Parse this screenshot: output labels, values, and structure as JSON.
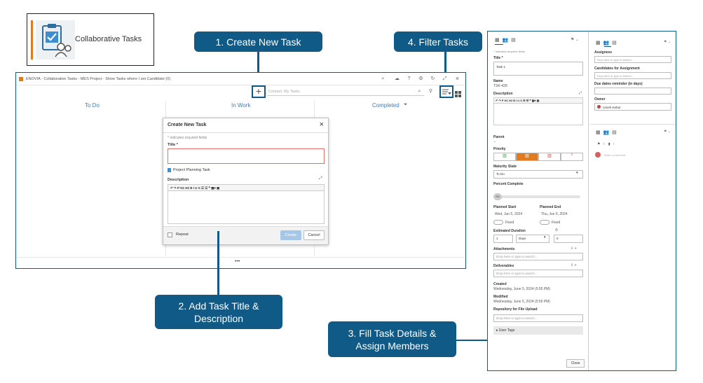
{
  "app_tile": {
    "name": "Collaborative Tasks",
    "icon": "clipboard-check-users-icon",
    "accent": "#e07b1f"
  },
  "callouts": {
    "create": "1. Create New Task",
    "add_title": "2. Add Task Title & Description",
    "fill_details": "3. Fill Task Details & Assign Members",
    "filter": "4. Filter Tasks",
    "color": "#0f5a87"
  },
  "window": {
    "title": "ENOVIA - Collaborative Tasks - MES Project - Show Tasks where I am Candidate (0)",
    "search_placeholder": "Context: My Tasks",
    "columns": [
      "To Do",
      "In Work",
      "Completed"
    ],
    "more": "•••"
  },
  "dialog": {
    "title": "Create New Task",
    "required_note": "* Indicates required fields",
    "title_label": "Title *",
    "template_link": "Project Planning Task",
    "description_label": "Description",
    "toolbar_text": "↶ ↷  P  H1 H2  B  I  U  S  ☰  ☰  ❞  ▦▾  ▣",
    "repeat_label": "Repeat",
    "create_button": "Create",
    "cancel_button": "Cancel"
  },
  "panel": {
    "required_note": "* Indicates required fields",
    "title_label": "Title *",
    "title_value": "Task 1",
    "name_label": "Name",
    "name_value": "TSK-428",
    "description_label": "Description",
    "parent_label": "Parent",
    "parent_value": "--",
    "priority_label": "Priority",
    "maturity_label": "Maturity State",
    "maturity_value": "To Do",
    "percent_label": "Percent Complete",
    "percent_value": "0%",
    "planned_start_label": "Planned Start",
    "planned_start_value": "Wed, Jun 5, 2024",
    "planned_end_label": "Planned End",
    "planned_end_value": "Thu, Jun 6, 2024",
    "fixed": "Fixed",
    "est_duration_label": "Estimated Duration",
    "est_duration_value": "1",
    "est_unit": "Days",
    "effort_value": "0",
    "attachments_label": "Attachments",
    "deliverables_label": "Deliverables",
    "drop_placeholder": "Drop here or type to search...",
    "created_label": "Created",
    "created_value": "Wednesday, June 5, 2024 (5:55 PM)",
    "modified_label": "Modified",
    "modified_value": "Wednesday, June 5, 2024 (5:55 PM)",
    "repo_label": "Repository for File Upload",
    "user_tags": "User Tags",
    "close_button": "Close",
    "assignees_label": "Assignees",
    "candidates_label": "Candidates for Assignment",
    "due_reminder_label": "Due dates reminder (in days)",
    "owner_label": "Owner",
    "owner_value": "Umeh Kehar",
    "comment_placeholder": "Write a comment"
  }
}
